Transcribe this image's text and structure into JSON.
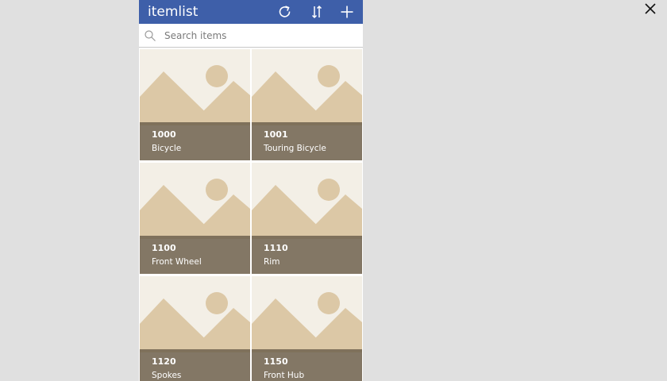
{
  "app": {
    "title": "itemlist",
    "header_color": "#3e5fa9",
    "icons": [
      "refresh-icon",
      "sort-icon",
      "add-icon"
    ]
  },
  "search": {
    "placeholder": "Search items",
    "value": ""
  },
  "items": [
    {
      "code": "1000",
      "name": "Bicycle"
    },
    {
      "code": "1001",
      "name": "Touring Bicycle"
    },
    {
      "code": "1100",
      "name": "Front Wheel"
    },
    {
      "code": "1110",
      "name": "Rim"
    },
    {
      "code": "1120",
      "name": "Spokes"
    },
    {
      "code": "1150",
      "name": "Front Hub"
    }
  ],
  "window": {
    "close_icon": "close-icon"
  }
}
